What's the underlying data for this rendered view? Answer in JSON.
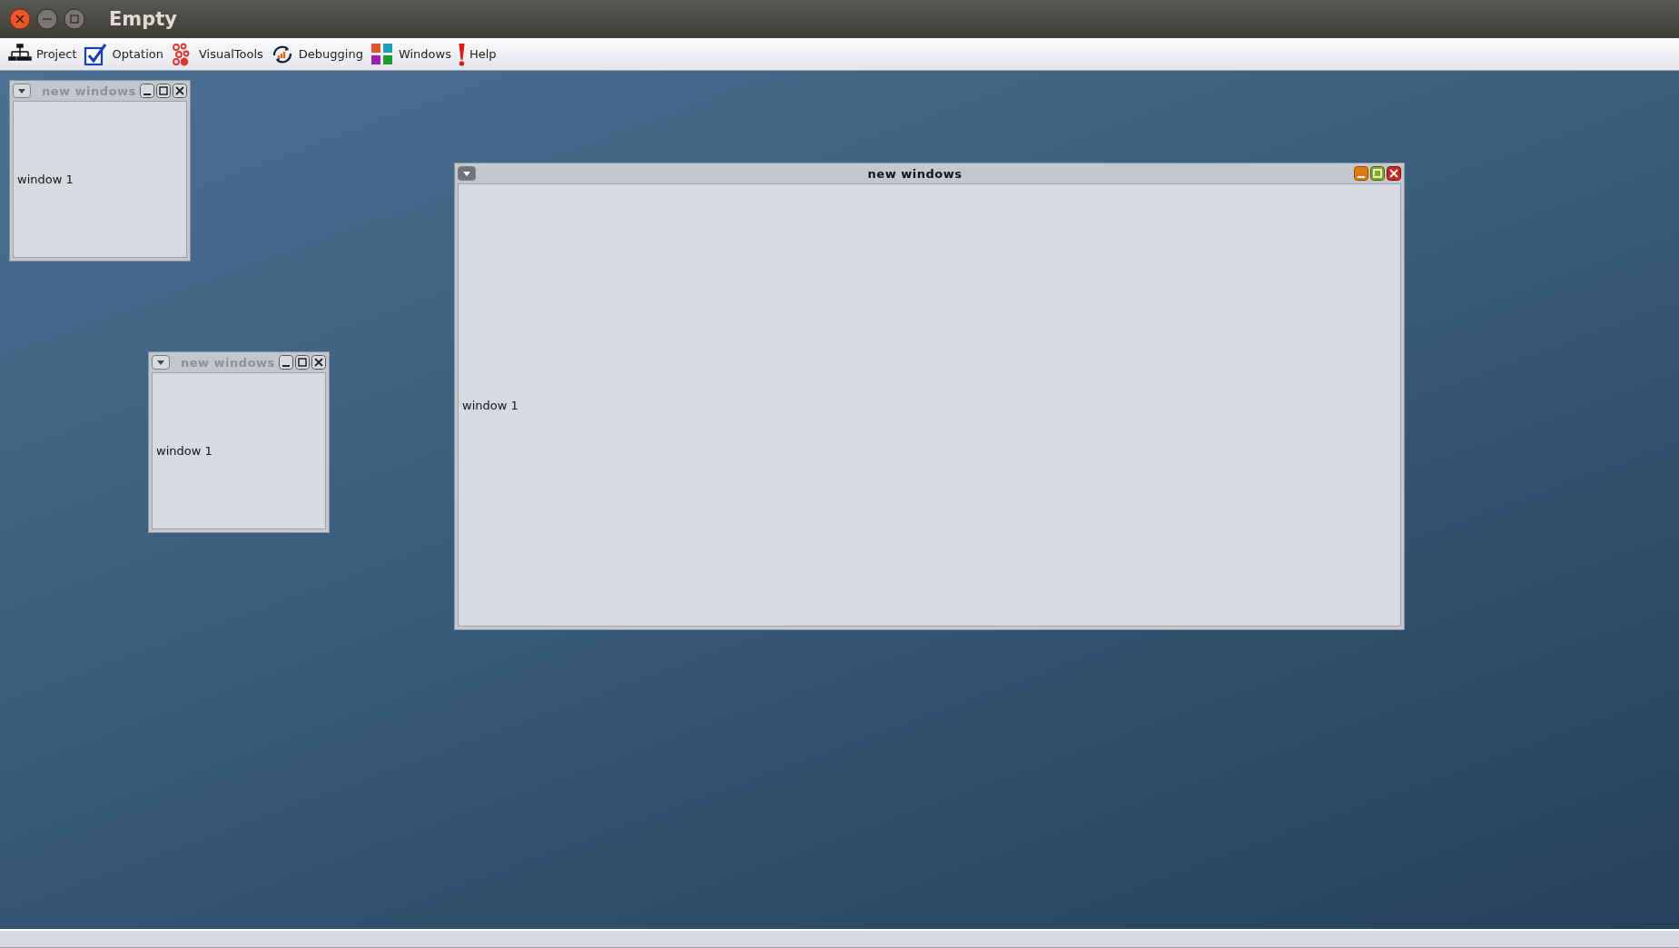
{
  "window": {
    "title": "Empty"
  },
  "menu": [
    {
      "label": "Project",
      "kind": "project"
    },
    {
      "label": "Optation",
      "kind": "check"
    },
    {
      "label": "VisualTools",
      "kind": "visual"
    },
    {
      "label": "Debugging",
      "kind": "debug"
    },
    {
      "label": "Windows",
      "kind": "windows"
    },
    {
      "label": "Help",
      "kind": "help"
    }
  ],
  "internal_windows": [
    {
      "title": "new windows",
      "content": "window 1",
      "active": false
    },
    {
      "title": "new windows",
      "content": "window 1",
      "active": false
    },
    {
      "title": "new windows",
      "content": "window 1",
      "active": true
    }
  ]
}
